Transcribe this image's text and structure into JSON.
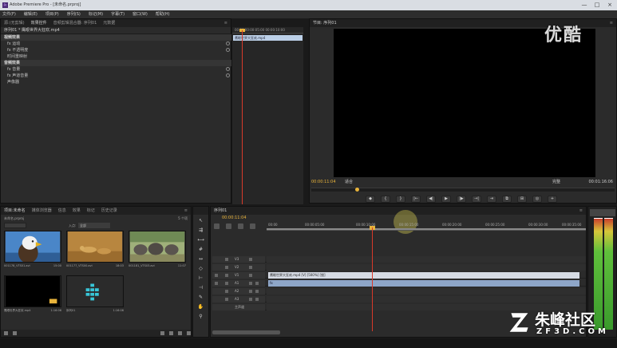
{
  "window": {
    "title": "Adobe Premiere Pro - [未命名.prproj]",
    "app_icon": "Pr",
    "buttons": [
      "—",
      "□",
      "×"
    ]
  },
  "menubar": [
    "文件(F)",
    "编辑(E)",
    "项目(P)",
    "序列(S)",
    "标记(M)",
    "字幕(T)",
    "窗口(W)",
    "帮助(H)"
  ],
  "effect_controls": {
    "tabs": [
      "源:(无剪辑)",
      "效果控件",
      "音频剪辑混合器: 序列01",
      "元数据"
    ],
    "clip_header": "序列01 * 鹰眼世界大狂欢.mp4",
    "sections": [
      {
        "title": "视频效果",
        "rows": [
          "fx 运动",
          "fx 不透明度",
          "时间重映射"
        ]
      },
      {
        "title": "音频效果",
        "rows": [
          "fx 音量",
          "fx 声道音量",
          "声像器"
        ]
      }
    ],
    "timeline_clip": "鹰眼世界大狂欢.mp4",
    "ruler": "00:00  00:00:05:00  00:00:10:00"
  },
  "program_monitor": {
    "tab": "节目: 序列01",
    "timecode_current": "00:00:11:04",
    "fit": "适合",
    "resolution": "完整",
    "timecode_duration": "00:01:16:06",
    "transport": [
      "◆",
      "{",
      "}",
      "|←",
      "◀|",
      "▶",
      "|▶",
      "→|",
      "⇥",
      "⧉",
      "⊞",
      "◎",
      "+"
    ]
  },
  "project_panel": {
    "tabs": [
      "项目:未命名",
      "媒体浏览器",
      "信息",
      "效果",
      "标记",
      "历史记录"
    ],
    "project_file": "未命名.prproj",
    "item_count": "5 个项",
    "in_label": "入点:",
    "in_value": "全部",
    "items": [
      {
        "name": "001178_VTS01.avi",
        "duration": "15:00",
        "icon": "eagle-thumb"
      },
      {
        "name": "001177_VTS00.avi",
        "duration": "18:03",
        "icon": "cheetah-thumb"
      },
      {
        "name": "001181_VTS03.avi",
        "duration": "11:07",
        "icon": "elephants-thumb"
      },
      {
        "name": "鹰眼世界大狂欢.mp4",
        "duration": "1:16:06",
        "icon": "black-video-thumb"
      },
      {
        "name": "序列01",
        "duration": "1:16:06",
        "icon": "sequence-thumb"
      }
    ]
  },
  "timeline": {
    "tab": "序列01",
    "timecode": "00:00:11:04",
    "ruler_ticks": [
      "00:00",
      "00:00:05:00",
      "00:00:10:00",
      "00:00:15:00",
      "00:00:20:00",
      "00:00:25:00",
      "00:00:30:00",
      "00:00:35:00"
    ],
    "tracks": [
      {
        "label": "V3",
        "clip": ""
      },
      {
        "label": "V2",
        "clip": ""
      },
      {
        "label": "V1",
        "clip": "鹰眼世界大狂欢.mp4 [V] [500%] [锁]"
      },
      {
        "label": "A1",
        "clip": "fx"
      },
      {
        "label": "A2",
        "clip": ""
      },
      {
        "label": "A3",
        "clip": ""
      },
      {
        "label": "主声道",
        "clip": ""
      }
    ]
  },
  "watermarks": {
    "youku": "优酷",
    "zf3d_name": "朱峰社区",
    "zf3d_domain": "ZF3D.COM"
  },
  "colors": {
    "playhead": "#d83a2a",
    "timecode": "#e8b33b",
    "video_clip": "#d6dbe4",
    "audio_clip": "#8ea6c8"
  }
}
